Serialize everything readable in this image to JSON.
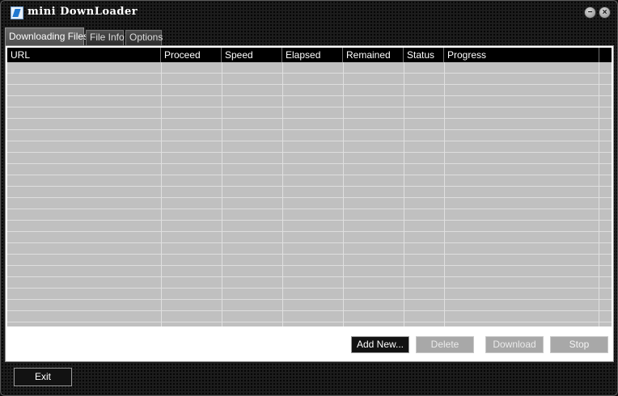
{
  "window": {
    "title": "mini DownLoader",
    "minimize_glyph": "−",
    "close_glyph": "×"
  },
  "tabs": [
    {
      "label": "Downloading Files",
      "active": true
    },
    {
      "label": "File Info",
      "active": false
    },
    {
      "label": "Options",
      "active": false
    }
  ],
  "table": {
    "columns": [
      "URL",
      "Proceed",
      "Speed",
      "Elapsed",
      "Remained",
      "Status",
      "Progress"
    ],
    "rows": []
  },
  "actions": {
    "add_new": "Add New...",
    "delete": "Delete",
    "download": "Download",
    "stop": "Stop"
  },
  "footer": {
    "exit": "Exit"
  },
  "colors": {
    "header_bg": "#000000",
    "list_bg": "#c0c0c0",
    "button_dark": "#121212",
    "button_disabled": "#a8a8a8"
  }
}
